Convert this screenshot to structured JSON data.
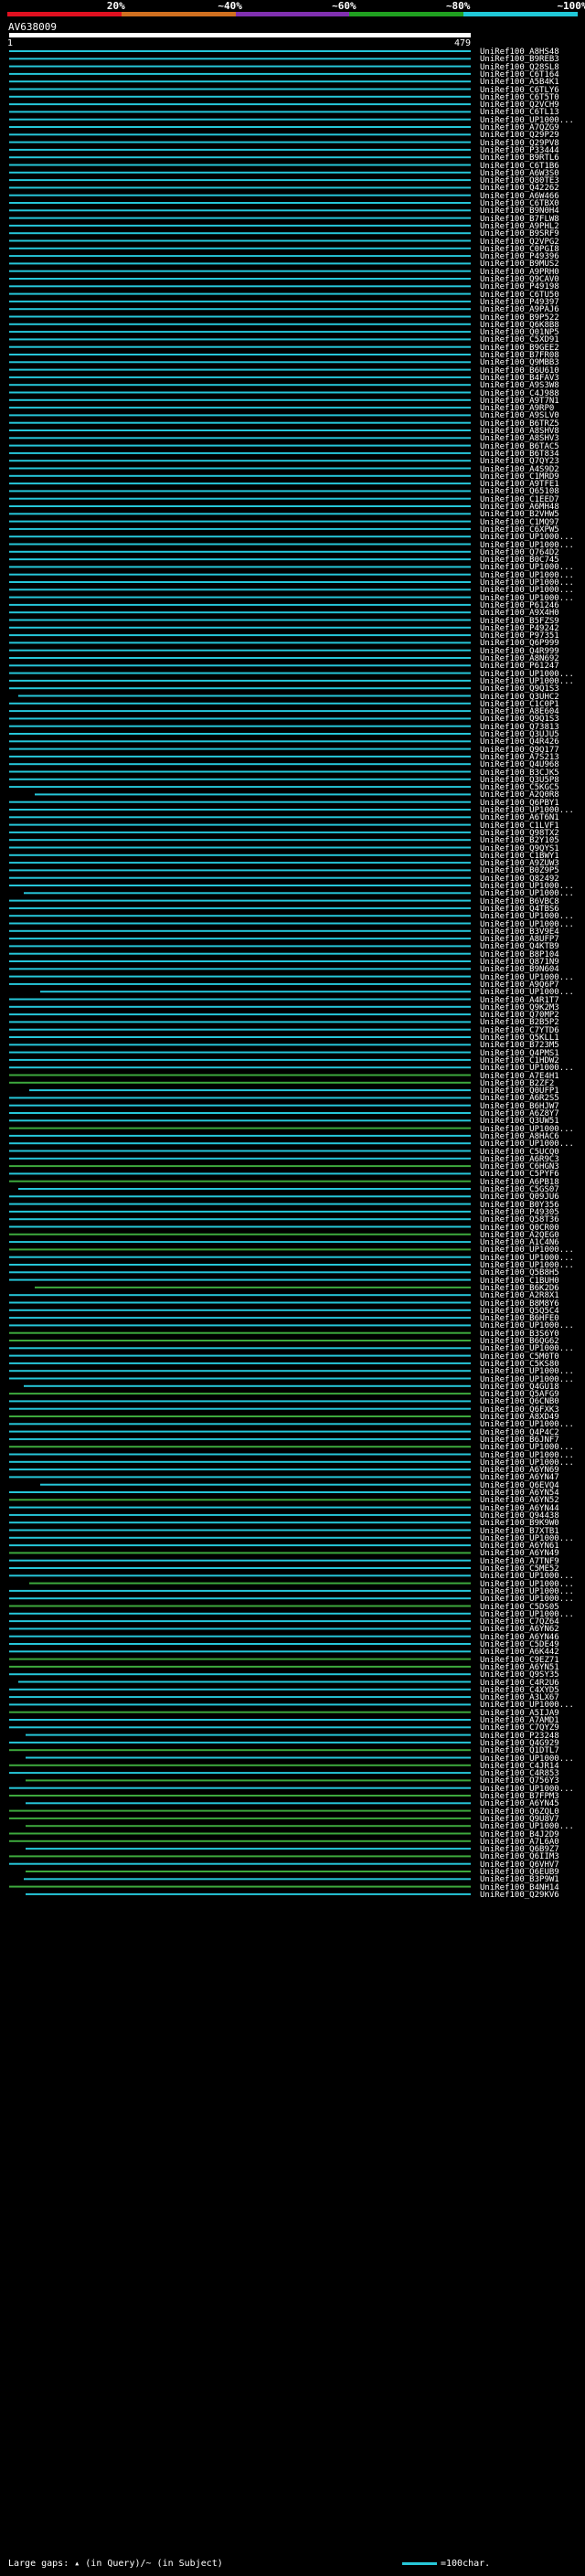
{
  "scale": {
    "labels": [
      "20%",
      "~40%",
      "~60%",
      "~80%",
      "~100%"
    ],
    "colors": [
      "#e01020",
      "#d07020",
      "#8030b0",
      "#20a020",
      "#20c8d8"
    ]
  },
  "query": {
    "name": "AV638009",
    "start": "1",
    "end": "479"
  },
  "colors": {
    "high": "#26c6d9",
    "mid": "#3da83d",
    "gap": "#000000",
    "background": "#000000"
  },
  "hits": [
    "UniRef100_A8HS48",
    "UniRef100_B9REB3",
    "UniRef100_Q28SL8",
    "UniRef100_C6T164",
    "UniRef100_A5B4K1",
    "UniRef100_C6TLY6",
    "UniRef100_C6T5T0",
    "UniRef100_Q2VCH9",
    "UniRef100_C6TL13",
    "UniRef100_UP1000...",
    "UniRef100_A7QZG9",
    "UniRef100_Q29P29",
    "UniRef100_Q29PV8",
    "UniRef100_P33444",
    "UniRef100_B9RTL6",
    "UniRef100_C6T1B6",
    "UniRef100_A6W3S0",
    "UniRef100_Q80TE3",
    "UniRef100_Q42262",
    "UniRef100_A6W466",
    "UniRef100_C6TBX0",
    "UniRef100_B9N0H4",
    "UniRef100_B7FLW8",
    "UniRef100_A9PHL2",
    "UniRef100_B9SRF9",
    "UniRef100_Q2VPG2",
    "UniRef100_C0PGI8",
    "UniRef100_P49396",
    "UniRef100_B9MUS2",
    "UniRef100_A9PRH0",
    "UniRef100_Q9CAV0",
    "UniRef100_P49198",
    "UniRef100_C6TU50",
    "UniRef100_P49397",
    "UniRef100_A9PAJ6",
    "UniRef100_B9P522",
    "UniRef100_Q6K8B8",
    "UniRef100_Q01NP5",
    "UniRef100_C5XD91",
    "UniRef100_B9GEE2",
    "UniRef100_B7FR08",
    "UniRef100_Q9MBB3",
    "UniRef100_B6U610",
    "UniRef100_B4FAV3",
    "UniRef100_A9S3W8",
    "UniRef100_C4J988",
    "UniRef100_A9T7N1",
    "UniRef100_A9RP0",
    "UniRef100_A9SLV0",
    "UniRef100_B6TRZ5",
    "UniRef100_A8SHV8",
    "UniRef100_A8SHV3",
    "UniRef100_B6TAC5",
    "UniRef100_B6T834",
    "UniRef100_Q7QY23",
    "UniRef100_A4S9D2",
    "UniRef100_C1MRD9",
    "UniRef100_A9TFE1",
    "UniRef100_Q65108",
    "UniRef100_C1EED7",
    "UniRef100_A6MH48",
    "UniRef100_B2VHW5",
    "UniRef100_C1MQ97",
    "UniRef100_C6XPW5",
    "UniRef100_UP1000...",
    "UniRef100_UP1000...",
    "UniRef100_Q764D2",
    "UniRef100_B0C745",
    "UniRef100_UP1000...",
    "UniRef100_UP1000...",
    "UniRef100_UP1000...",
    "UniRef100_UP1000...",
    "UniRef100_UP1000...",
    "UniRef100_P61246",
    "UniRef100_A9X4H0",
    "UniRef100_B5FZS9",
    "UniRef100_P49242",
    "UniRef100_P97351",
    "UniRef100_Q6P999",
    "UniRef100_Q4R999",
    "UniRef100_A8N692",
    "UniRef100_P61247",
    "UniRef100_UP1000...",
    "UniRef100_UP1000...",
    "UniRef100_Q9Q1S3",
    "UniRef100_Q3UHC2",
    "UniRef100_C1C0P1",
    "UniRef100_A8E604",
    "UniRef100_Q9Q1S3",
    "UniRef100_Q73813",
    "UniRef100_Q3UJU5",
    "UniRef100_Q4R426",
    "UniRef100_Q9Q177",
    "UniRef100_A7S213",
    "UniRef100_Q4U968",
    "UniRef100_B3CJK5",
    "UniRef100_Q3U5P8",
    "UniRef100_C5KGC5",
    "UniRef100_A2Q0R8",
    "UniRef100_Q6PBY1",
    "UniRef100_UP1000...",
    "UniRef100_A6T6N1",
    "UniRef100_C1LVF1",
    "UniRef100_Q98TX2",
    "UniRef100_B2Y105",
    "UniRef100_Q9QYS1",
    "UniRef100_C1BWY1",
    "UniRef100_A9ZUW3",
    "UniRef100_B0Z9P5",
    "UniRef100_Q82492",
    "UniRef100_UP1000...",
    "UniRef100_UP1000...",
    "UniRef100_B6VBC8",
    "UniRef100_Q4TBS6",
    "UniRef100_UP1000...",
    "UniRef100_UP1000...",
    "UniRef100_B3V9E4",
    "UniRef100_A8UFP7",
    "UniRef100_Q4KTB9",
    "UniRef100_B8P104",
    "UniRef100_Q871N9",
    "UniRef100_B9N604",
    "UniRef100_UP1000...",
    "UniRef100_A9Q6P7",
    "UniRef100_UP1000...",
    "UniRef100_A4R1T7",
    "UniRef100_Q9K2M3",
    "UniRef100_Q70MP2",
    "UniRef100_B2B5P2",
    "UniRef100_C7YTD6",
    "UniRef100_Q5KLL1",
    "UniRef100_B723M5",
    "UniRef100_Q4PMS1",
    "UniRef100_C1HDW2",
    "UniRef100_UP1000...",
    "UniRef100_A7E4H1",
    "UniRef100_B2ZF2",
    "UniRef100_Q0UFP1",
    "UniRef100_A6R2S5",
    "UniRef100_B6HJW7",
    "UniRef100_A6Z8Y7",
    "UniRef100_Q3UW51",
    "UniRef100_UP1000...",
    "UniRef100_A8HAC6",
    "UniRef100_UP1000...",
    "UniRef100_C5UCQ0",
    "UniRef100_A6R9C3",
    "UniRef100_C6HGN3",
    "UniRef100_C5PYF6",
    "UniRef100_A6PB18",
    "UniRef100_C5GS07",
    "UniRef100_Q09JU6",
    "UniRef100_B0Y356",
    "UniRef100_P49305",
    "UniRef100_Q58T36",
    "UniRef100_Q0CR00",
    "UniRef100_A2QEG0",
    "UniRef100_A1C4N6",
    "UniRef100_UP1000...",
    "UniRef100_UP1000...",
    "UniRef100_UP1000...",
    "UniRef100_Q5B8H5",
    "UniRef100_C1BUH0",
    "UniRef100_B6K2D6",
    "UniRef100_A2R8X1",
    "UniRef100_B8M8Y6",
    "UniRef100_Q5Q5C4",
    "UniRef100_B6HFE0",
    "UniRef100_UP1000...",
    "UniRef100_B3S6Y0",
    "UniRef100_B6QG62",
    "UniRef100_UP1000...",
    "UniRef100_C5M0T0",
    "UniRef100_C5KS80",
    "UniRef100_UP1000...",
    "UniRef100_UP1000...",
    "UniRef100_Q4GU18",
    "UniRef100_Q5AFG9",
    "UniRef100_Q6CNB0",
    "UniRef100_Q6FXK3",
    "UniRef100_A8XD49",
    "UniRef100_UP1000...",
    "UniRef100_Q4P4C2",
    "UniRef100_B6JNF7",
    "UniRef100_UP1000...",
    "UniRef100_UP1000...",
    "UniRef100_UP1000...",
    "UniRef100_A6YN69",
    "UniRef100_A6YN47",
    "UniRef100_Q6EVQ4",
    "UniRef100_A6YN54",
    "UniRef100_A6YN52",
    "UniRef100_A6YN44",
    "UniRef100_Q94438",
    "UniRef100_B9K9W0",
    "UniRef100_B7XTB1",
    "UniRef100_UP1000...",
    "UniRef100_A6YN61",
    "UniRef100_A6YN49",
    "UniRef100_A7TNF9",
    "UniRef100_C5ME52",
    "UniRef100_UP1000...",
    "UniRef100_UP1000...",
    "UniRef100_UP1000...",
    "UniRef100_UP1000...",
    "UniRef100_C5DS05",
    "UniRef100_UP1000...",
    "UniRef100_C7QZ64",
    "UniRef100_A6YN62",
    "UniRef100_A6YN46",
    "UniRef100_C5DE49",
    "UniRef100_A6K442",
    "UniRef100_C9EZ71",
    "UniRef100_A6YN51",
    "UniRef100_Q9SY35",
    "UniRef100_C4R2U6",
    "UniRef100_C4XYD5",
    "UniRef100_A3LX67",
    "UniRef100_UP1000...",
    "UniRef100_A5IJA9",
    "UniRef100_A7AMD1",
    "UniRef100_C7QYZ9",
    "UniRef100_P23248",
    "UniRef100_Q4G929",
    "UniRef100_Q1DTL7",
    "UniRef100_UP1000...",
    "UniRef100_C4JR14",
    "UniRef100_C4R853",
    "UniRef100_Q756Y3",
    "UniRef100_UP1000...",
    "UniRef100_B7FPM3",
    "UniRef100_A6YN45",
    "UniRef100_Q6ZQL0",
    "UniRef100_Q9U8V7",
    "UniRef100_UP1000...",
    "UniRef100_B4J2D9",
    "UniRef100_A7L6A0",
    "UniRef100_Q6B9Z7",
    "UniRef100_Q6IIM3",
    "UniRef100_Q6VHV7",
    "UniRef100_Q6EUB9",
    "UniRef100_B3P9W1",
    "UniRef100_B4NH14",
    "UniRef100_Q29KV6"
  ],
  "footer": {
    "text": "Large gaps: ▴ (in Query)/~ (in Subject)",
    "key": "=100char."
  }
}
